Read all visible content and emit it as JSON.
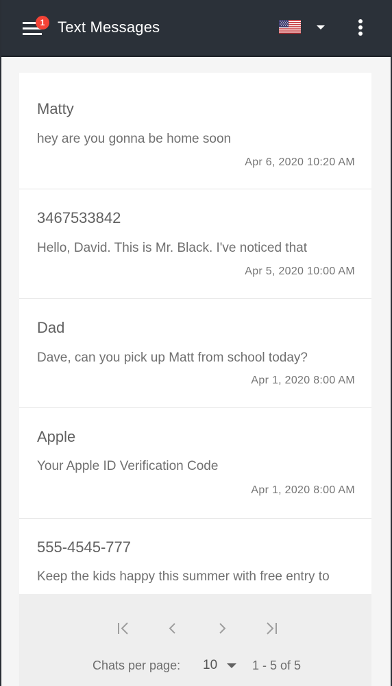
{
  "toolbar": {
    "title": "Text Messages",
    "notification_count": "1",
    "language_flag": "us-flag-icon"
  },
  "messages": [
    {
      "name": "Matty",
      "preview": "hey are you gonna be home soon",
      "time": "Apr 6, 2020 10:20 AM"
    },
    {
      "name": "3467533842",
      "preview": "Hello, David. This is Mr. Black. I've noticed that",
      "time": "Apr 5, 2020 10:00 AM"
    },
    {
      "name": "Dad",
      "preview": "Dave, can you pick up Matt from school today?",
      "time": "Apr 1, 2020 8:00 AM"
    },
    {
      "name": "Apple",
      "preview": "Your Apple ID Verification Code",
      "time": "Apr 1, 2020 8:00 AM"
    },
    {
      "name": "555-4545-777",
      "preview": "Keep the kids happy this summer with free entry to",
      "time": ""
    }
  ],
  "pagination": {
    "per_page_label": "Chats per page:",
    "per_page_value": "10",
    "range_label": "1 - 5 of 5"
  },
  "colors": {
    "toolbar_bg": "#2b3139",
    "badge": "#f44336",
    "page_bg": "#f5f5f5",
    "card_bg": "#ffffff"
  }
}
